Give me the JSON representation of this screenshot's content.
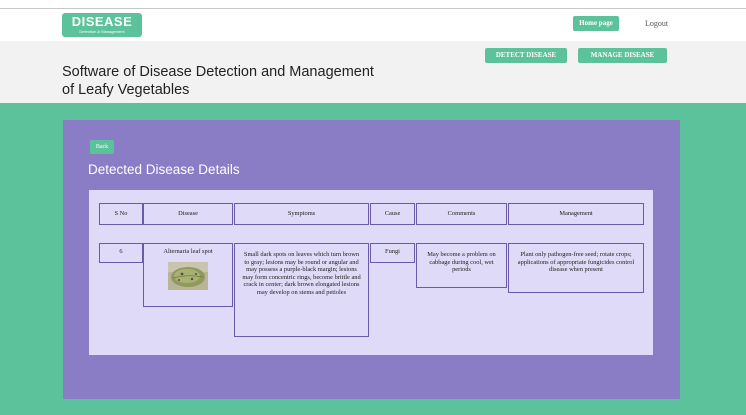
{
  "nav": {
    "logo_main": "DISEASE",
    "logo_sub": "Detection & Management",
    "home_label": "Home page",
    "logout_label": "Logout",
    "detect_label": "DETECT DISEASE",
    "manage_label": "MANAGE DISEASE"
  },
  "hero": {
    "title_line1": "Software of Disease Detection and Management",
    "title_line2": "of Leafy Vegetables"
  },
  "panel": {
    "back_label": "Back",
    "section_title": "Detected Disease Details"
  },
  "table": {
    "headers": {
      "sno": "S No",
      "disease": "Disease",
      "symptoms": "Symptoms",
      "cause": "Cause",
      "comments": "Comments",
      "management": "Management"
    },
    "row": {
      "sno": "6",
      "disease": "Alternaria leaf spot",
      "image": "leaf-image",
      "symptoms": "Small dark spots on leaves which turn brown to gray; lesions may be round or angular and may possess a purple-black margin; lesions may form concentric rings, become brittle and crack in center; dark brown elongated lesions may develop on stems and petioles",
      "cause": "Fungi",
      "comments": "May become a problem on cabbage during cool, wet periods",
      "management": "Plant only pathogen-free seed; rotate crops; applications of appropriate fungicides control disease when present"
    }
  },
  "colors": {
    "accent_green": "#5cc29b",
    "panel_purple": "#8a7cc5",
    "table_bg": "#dedaf7",
    "border": "#6a5aa8"
  }
}
